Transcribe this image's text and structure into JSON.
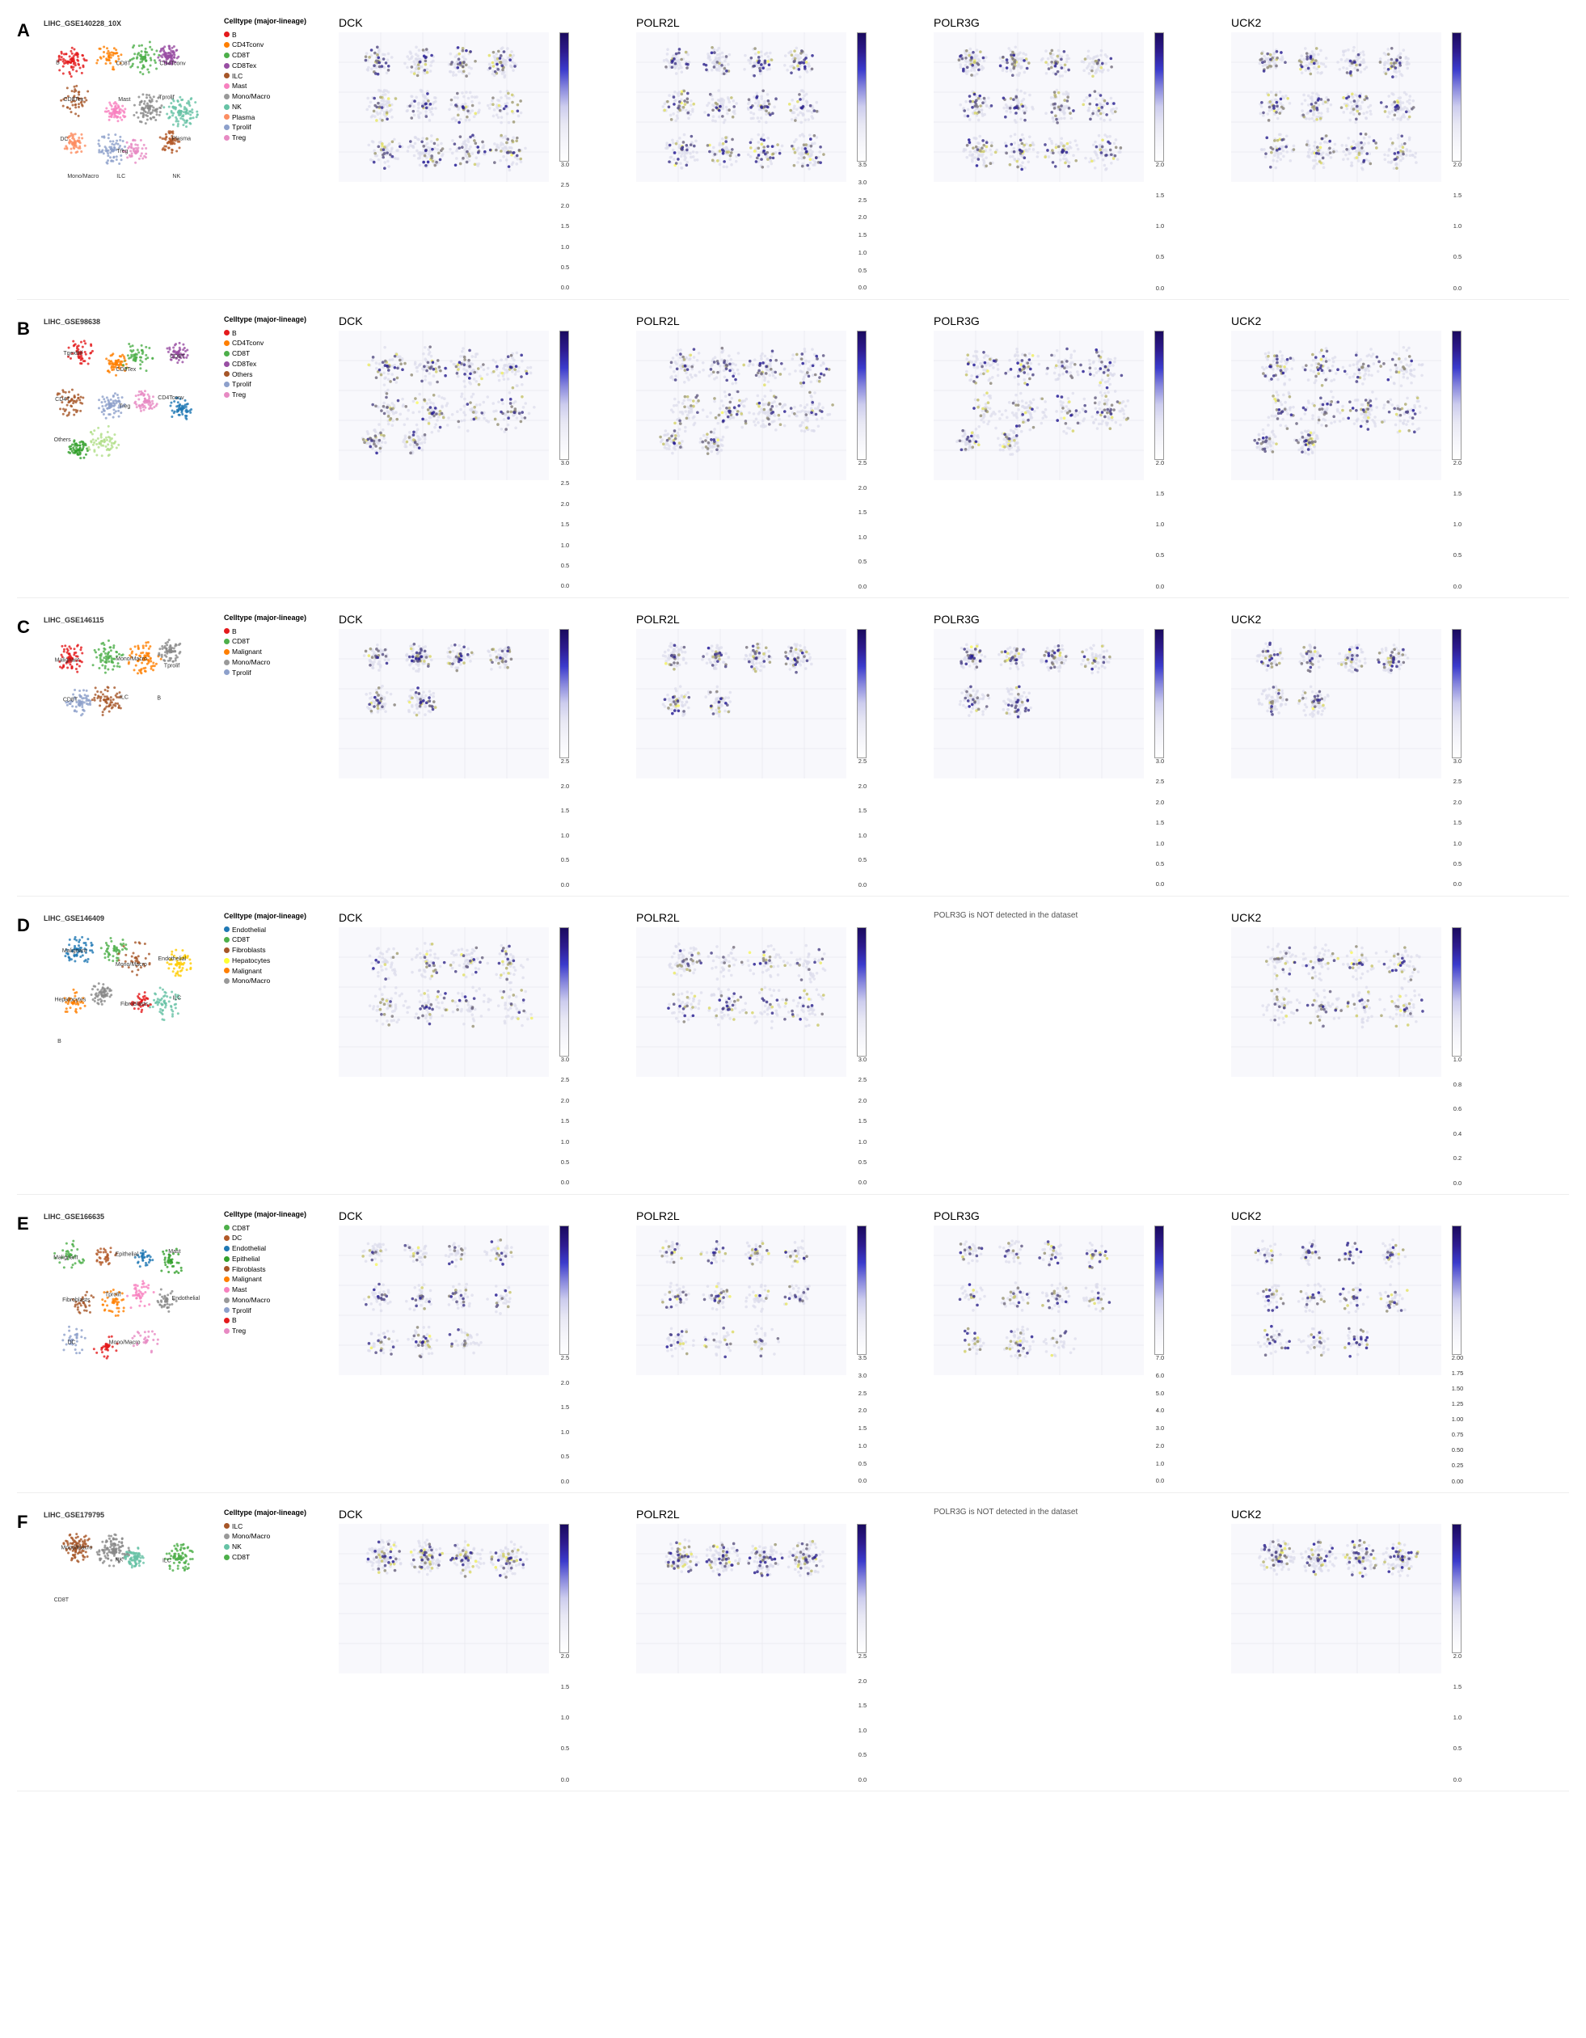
{
  "figure": {
    "panels": [
      {
        "id": "A",
        "dataset": "LIHC_GSE140228_10X",
        "genes": [
          "DCK",
          "POLR2L",
          "POLR3G",
          "UCK2"
        ],
        "legend_title": "Celltype (major-lineage)",
        "legend_items": [
          {
            "label": "B",
            "color": "#e41a1c"
          },
          {
            "label": "CD4Tconv",
            "color": "#ff7f00"
          },
          {
            "label": "CD8T",
            "color": "#4daf4a"
          },
          {
            "label": "CD8Tex",
            "color": "#984ea3"
          },
          {
            "label": "ILC",
            "color": "#a65628"
          },
          {
            "label": "Mast",
            "color": "#f781bf"
          },
          {
            "label": "Mono/Macro",
            "color": "#999999"
          },
          {
            "label": "NK",
            "color": "#66c2a5"
          },
          {
            "label": "Plasma",
            "color": "#fc8d62"
          },
          {
            "label": "Tprolif",
            "color": "#8da0cb"
          },
          {
            "label": "Treg",
            "color": "#e78ac3"
          }
        ],
        "colorbar_values": {
          "DCK": [
            "3.0",
            "2.5",
            "2.0",
            "1.5",
            "1.0",
            "0.5",
            "0.0"
          ],
          "POLR2L": [
            "3.5",
            "3.0",
            "2.5",
            "2.0",
            "1.5",
            "1.0",
            "0.5",
            "0.0"
          ],
          "POLR3G": [
            "2.0",
            "1.5",
            "1.0",
            "0.5",
            "0.0"
          ],
          "UCK2": [
            "2.0",
            "1.5",
            "1.0",
            "0.5",
            "0.0"
          ]
        },
        "polr3g_not_detected": false,
        "umap_labels": [
          "B",
          "CD8T",
          "CD4Tconv",
          "CD8Tex",
          "Mast",
          "Tprolif",
          "DC",
          "Treg",
          "Plasma",
          "Mono/Macro",
          "ILC",
          "NK"
        ]
      },
      {
        "id": "B",
        "dataset": "LIHC_GSE98638",
        "genes": [
          "DCK",
          "POLR2L",
          "POLR3G",
          "UCK2"
        ],
        "legend_title": "Celltype (major-lineage)",
        "legend_items": [
          {
            "label": "B",
            "color": "#e41a1c"
          },
          {
            "label": "CD4Tconv",
            "color": "#ff7f00"
          },
          {
            "label": "CD8T",
            "color": "#4daf4a"
          },
          {
            "label": "CD8Tex",
            "color": "#984ea3"
          },
          {
            "label": "Others",
            "color": "#a65628"
          },
          {
            "label": "Tprolif",
            "color": "#8da0cb"
          },
          {
            "label": "Treg",
            "color": "#e78ac3"
          }
        ],
        "colorbar_values": {
          "DCK": [
            "3.0",
            "2.5",
            "2.0",
            "1.5",
            "1.0",
            "0.5",
            "0.0"
          ],
          "POLR2L": [
            "2.5",
            "2.0",
            "1.5",
            "1.0",
            "0.5",
            "0.0"
          ],
          "POLR3G": [
            "2.0",
            "1.5",
            "1.0",
            "0.5",
            "0.0"
          ],
          "UCK2": [
            "2.0",
            "1.5",
            "1.0",
            "0.5",
            "0.0"
          ]
        },
        "polr3g_not_detected": false,
        "umap_labels": [
          "TgexBif",
          "CD8Tex",
          "CD8T",
          "CD4T",
          "Treg",
          "CD4Tconv",
          "Others"
        ]
      },
      {
        "id": "C",
        "dataset": "LIHC_GSE146115",
        "genes": [
          "DCK",
          "POLR2L",
          "POLR3G",
          "UCK2"
        ],
        "legend_title": "Celltype (major-lineage)",
        "legend_items": [
          {
            "label": "B",
            "color": "#e41a1c"
          },
          {
            "label": "CD8T",
            "color": "#4daf4a"
          },
          {
            "label": "Malignant",
            "color": "#ff7f00"
          },
          {
            "label": "Mono/Macro",
            "color": "#999999"
          },
          {
            "label": "Tprolif",
            "color": "#8da0cb"
          }
        ],
        "colorbar_values": {
          "DCK": [
            "2.5",
            "2.0",
            "1.5",
            "1.0",
            "0.5",
            "0.0"
          ],
          "POLR2L": [
            "2.5",
            "2.0",
            "1.5",
            "1.0",
            "0.5",
            "0.0"
          ],
          "POLR3G": [
            "3.0",
            "2.5",
            "2.0",
            "1.5",
            "1.0",
            "0.5",
            "0.0"
          ],
          "UCK2": [
            "3.0",
            "2.5",
            "2.0",
            "1.5",
            "1.0",
            "0.5",
            "0.0"
          ]
        },
        "polr3g_not_detected": false,
        "umap_labels": [
          "Malignant",
          "Mono/Macro",
          "Tprolif",
          "CD8T",
          "ILC",
          "B"
        ]
      },
      {
        "id": "D",
        "dataset": "LIHC_GSE146409",
        "genes": [
          "DCK",
          "POLR2L",
          "POLR3G",
          "UCK2"
        ],
        "legend_title": "Celltype (major-lineage)",
        "legend_items": [
          {
            "label": "Endothelial",
            "color": "#1f78b4"
          },
          {
            "label": "CD8T",
            "color": "#4daf4a"
          },
          {
            "label": "Fibroblasts",
            "color": "#a65628"
          },
          {
            "label": "Hepatocytes",
            "color": "#ffff33"
          },
          {
            "label": "Malignant",
            "color": "#ff7f00"
          },
          {
            "label": "Mono/Macro",
            "color": "#999999"
          }
        ],
        "colorbar_values": {
          "DCK": [
            "3.0",
            "2.5",
            "2.0",
            "1.5",
            "1.0",
            "0.5",
            "0.0"
          ],
          "POLR2L": [
            "3.0",
            "2.5",
            "2.0",
            "1.5",
            "1.0",
            "0.5",
            "0.0"
          ],
          "POLR3G": null,
          "UCK2": [
            "1.0",
            "0.8",
            "0.6",
            "0.4",
            "0.2",
            "0.0"
          ]
        },
        "polr3g_not_detected": true,
        "umap_labels": [
          "Malignant",
          "Mono/Macro",
          "Endothelial",
          "Hepatocytes",
          "Fibroblasts",
          "ILC",
          "B"
        ]
      },
      {
        "id": "E",
        "dataset": "LIHC_GSE166635",
        "genes": [
          "DCK",
          "POLR2L",
          "POLR3G",
          "UCK2"
        ],
        "legend_title": "Celltype (major-lineage)",
        "legend_items": [
          {
            "label": "CD8T",
            "color": "#4daf4a"
          },
          {
            "label": "DC",
            "color": "#b15928"
          },
          {
            "label": "Endothelial",
            "color": "#1f78b4"
          },
          {
            "label": "Epithelial",
            "color": "#33a02c"
          },
          {
            "label": "Fibroblasts",
            "color": "#a65628"
          },
          {
            "label": "Malignant",
            "color": "#ff7f00"
          },
          {
            "label": "Mast",
            "color": "#f781bf"
          },
          {
            "label": "Mono/Macro",
            "color": "#999999"
          },
          {
            "label": "Tprolif",
            "color": "#8da0cb"
          },
          {
            "label": "B",
            "color": "#e41a1c"
          },
          {
            "label": "Treg",
            "color": "#e78ac3"
          }
        ],
        "colorbar_values": {
          "DCK": [
            "2.5",
            "2.0",
            "1.5",
            "1.0",
            "0.5",
            "0.0"
          ],
          "POLR2L": [
            "3.5",
            "3.0",
            "2.5",
            "2.0",
            "1.5",
            "1.0",
            "0.5",
            "0.0"
          ],
          "POLR3G": [
            "7.0",
            "6.0",
            "5.0",
            "4.0",
            "3.0",
            "2.0",
            "1.0",
            "0.0"
          ],
          "UCK2": [
            "2.00",
            "1.75",
            "1.50",
            "1.25",
            "1.00",
            "0.75",
            "0.50",
            "0.25",
            "0.00"
          ]
        },
        "polr3g_not_detected": false,
        "umap_labels": [
          "Malignant",
          "Epithelial",
          "Mast",
          "Fibroblasts",
          "Tprolif",
          "Endothelial",
          "DC",
          "Mono/Macro"
        ]
      },
      {
        "id": "F",
        "dataset": "LIHC_GSE179795",
        "genes": [
          "DCK",
          "POLR2L",
          "POLR3G",
          "UCK2"
        ],
        "legend_title": "Celltype (major-lineage)",
        "legend_items": [
          {
            "label": "ILC",
            "color": "#a65628"
          },
          {
            "label": "Mono/Macro",
            "color": "#999999"
          },
          {
            "label": "NK",
            "color": "#66c2a5"
          },
          {
            "label": "CD8T",
            "color": "#4daf4a"
          }
        ],
        "colorbar_values": {
          "DCK": [
            "2.0",
            "1.5",
            "1.0",
            "0.5",
            "0.0"
          ],
          "POLR2L": [
            "2.5",
            "2.0",
            "1.5",
            "1.0",
            "0.5",
            "0.0"
          ],
          "POLR3G": null,
          "UCK2": [
            "2.0",
            "1.5",
            "1.0",
            "0.5",
            "0.0"
          ]
        },
        "polr3g_not_detected": true,
        "umap_labels": [
          "Mono/Macro",
          "NK",
          "ILC",
          "CD8T"
        ]
      }
    ]
  }
}
